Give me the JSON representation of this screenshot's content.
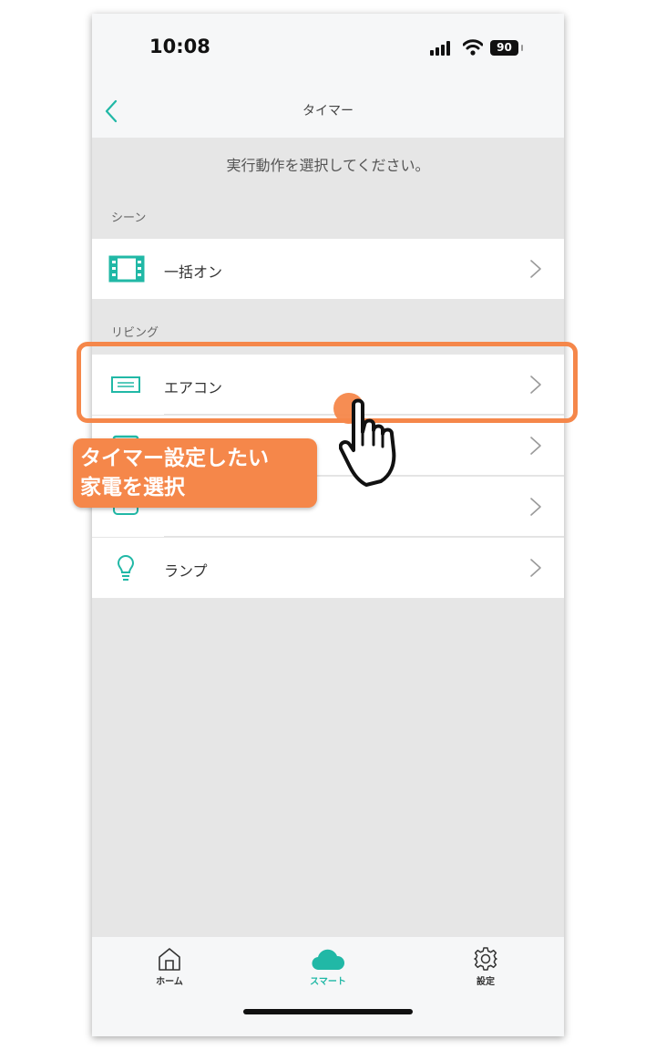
{
  "status_bar": {
    "time": "10:08",
    "battery": "90"
  },
  "nav": {
    "title": "タイマー"
  },
  "prompt": "実行動作を選択してください。",
  "sections": [
    {
      "label": "シーン",
      "items": [
        {
          "label": "一括オン",
          "icon": "film-icon"
        }
      ]
    },
    {
      "label": "リビング",
      "items": [
        {
          "label": "エアコン",
          "icon": "air-conditioner-icon"
        },
        {
          "label": "",
          "icon": "tv-icon"
        },
        {
          "label": "",
          "icon": "ceiling-light-icon"
        },
        {
          "label": "ランプ",
          "icon": "bulb-icon"
        }
      ]
    }
  ],
  "tabs": [
    {
      "label": "ホーム",
      "icon": "home-icon",
      "active": false
    },
    {
      "label": "スマート",
      "icon": "cloud-icon",
      "active": true
    },
    {
      "label": "設定",
      "icon": "gear-icon",
      "active": false
    }
  ],
  "annotation": {
    "callout_line1": "タイマー設定したい",
    "callout_line2": "家電を選択"
  },
  "colors": {
    "accent": "#21b8a6",
    "annotation": "#f5874a",
    "background": "#e6e6e6"
  }
}
